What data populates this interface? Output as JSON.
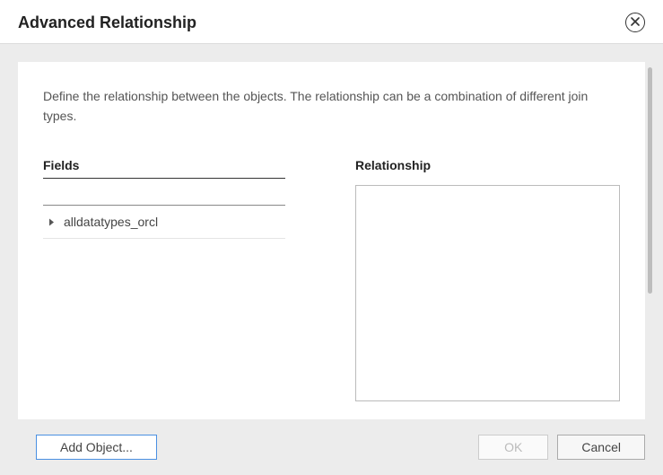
{
  "dialog": {
    "title": "Advanced Relationship",
    "description": "Define the relationship between the objects. The relationship can be a combination of different join types."
  },
  "fields": {
    "label": "Fields",
    "items": [
      {
        "label": "alldatatypes_orcl"
      }
    ]
  },
  "relationship": {
    "label": "Relationship"
  },
  "footer": {
    "add_object_label": "Add Object...",
    "ok_label": "OK",
    "cancel_label": "Cancel"
  }
}
